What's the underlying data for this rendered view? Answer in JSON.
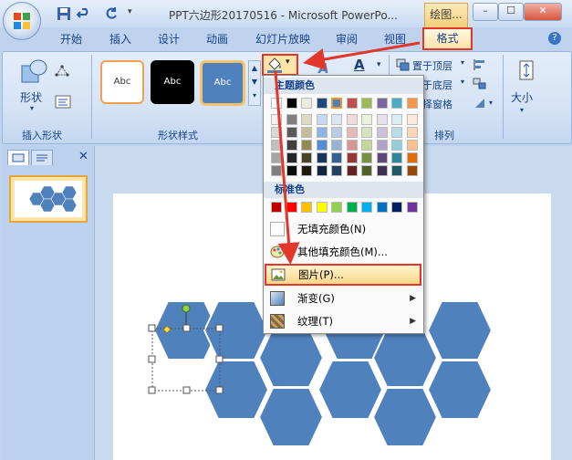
{
  "window": {
    "title": "PPT六边形20170516 - Microsoft PowerPo...",
    "contextual_tab_title": "绘图...",
    "controls": [
      "–",
      "☐",
      "✕"
    ]
  },
  "tabs": [
    "开始",
    "插入",
    "设计",
    "动画",
    "幻灯片放映",
    "审阅",
    "视图",
    "格式"
  ],
  "ribbon": {
    "insert_shapes": {
      "shapes_label": "形状",
      "group_label": "插入形状"
    },
    "shape_styles": {
      "group_label": "形状样式",
      "style_text": "Abc"
    },
    "arrange": {
      "bring_front": "置于顶层",
      "send_back": "置于底层",
      "selection_pane": "选择窗格",
      "group_label": "排列"
    },
    "size_label": "大小"
  },
  "fill_menu": {
    "theme_colors_label": "主题颜色",
    "standard_colors_label": "标准色",
    "items": [
      {
        "label": "无填充颜色(N)",
        "icon": "no-fill-icon"
      },
      {
        "label": "其他填充颜色(M)...",
        "icon": "palette-icon"
      },
      {
        "label": "图片(P)...",
        "icon": "picture-icon",
        "highlighted": true
      },
      {
        "label": "渐变(G)",
        "icon": "gradient-icon",
        "submenu": true
      },
      {
        "label": "纹理(T)",
        "icon": "texture-icon",
        "submenu": true
      }
    ],
    "theme_top_row": [
      "#ffffff",
      "#000000",
      "#eeece1",
      "#1f497d",
      "#4f81bd",
      "#c0504d",
      "#9bbb59",
      "#8064a2",
      "#4bacc6",
      "#f79646"
    ],
    "theme_columns": [
      [
        "#f2f2f2",
        "#d8d8d8",
        "#bfbfbf",
        "#a5a5a5",
        "#7f7f7f"
      ],
      [
        "#7f7f7f",
        "#595959",
        "#3f3f3f",
        "#262626",
        "#0c0c0c"
      ],
      [
        "#ddd9c3",
        "#c4bd97",
        "#938953",
        "#494429",
        "#1d1b10"
      ],
      [
        "#c6d9f0",
        "#8db3e2",
        "#548dd4",
        "#17365d",
        "#0f243e"
      ],
      [
        "#dbe5f1",
        "#b8cce4",
        "#95b3d7",
        "#366092",
        "#244061"
      ],
      [
        "#f2dcdb",
        "#e5b9b7",
        "#d99694",
        "#953734",
        "#632423"
      ],
      [
        "#ebf1dd",
        "#d7e3bc",
        "#c3d69b",
        "#76923c",
        "#4f6128"
      ],
      [
        "#e5e0ec",
        "#ccc1d9",
        "#b2a2c7",
        "#5f497a",
        "#3f3151"
      ],
      [
        "#dbeef3",
        "#b7dde8",
        "#92cddc",
        "#31859b",
        "#205867"
      ],
      [
        "#fdeada",
        "#fbd5b5",
        "#fac08f",
        "#e36c09",
        "#974806"
      ]
    ],
    "standard_row": [
      "#c00000",
      "#ff0000",
      "#ffc000",
      "#ffff00",
      "#92d050",
      "#00b050",
      "#00b0f0",
      "#0070c0",
      "#002060",
      "#7030a0"
    ]
  },
  "slides_panel": {
    "slide_number": "1"
  },
  "colors": {
    "hex_fill": "#4f81bd",
    "hex_stroke": "#ffffff",
    "annotation_red": "#e2372a"
  }
}
